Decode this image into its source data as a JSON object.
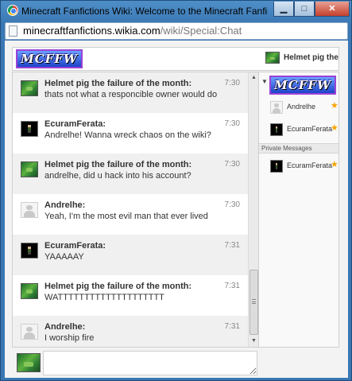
{
  "window": {
    "title": "Minecraft Fanfictions Wiki: Welcome to the Minecraft Fanfictions ...",
    "minimize_glyph": "▁",
    "maximize_glyph": "□",
    "close_glyph": "✕"
  },
  "address": {
    "domain": "minecraftfanfictions.wikia.com",
    "path": "/wiki/Special:Chat"
  },
  "header": {
    "logo_text": "MCFFW",
    "current_user": "Helmet pig the ..."
  },
  "messages": [
    {
      "author": "Helmet pig the failure of the month:",
      "text": "thats not what a responcible owner would do",
      "time": "7:30",
      "avatar": "pig-avatar-icon"
    },
    {
      "author": "EcuramFerata:",
      "text": "Andrelhe! Wanna wreck chaos on the wiki?",
      "time": "7:30",
      "avatar": "character-avatar-icon"
    },
    {
      "author": "Helmet pig the failure of the month:",
      "text": "andrelhe, did u hack into his account?",
      "time": "7:30",
      "avatar": "pig-avatar-icon"
    },
    {
      "author": "Andrelhe:",
      "text": "Yeah, I'm the most evil man that ever lived",
      "time": "7:30",
      "avatar": "default-avatar-icon"
    },
    {
      "author": "EcuramFerata:",
      "text": "YAAAAAY",
      "time": "7:31",
      "avatar": "character-avatar-icon"
    },
    {
      "author": "Helmet pig the failure of the month:",
      "text": "WATTTTTTTTTTTTTTTTTTTT",
      "time": "7:31",
      "avatar": "pig-avatar-icon"
    },
    {
      "author": "Andrelhe:",
      "text": "I worship fire",
      "time": "7:31",
      "avatar": "default-avatar-icon"
    }
  ],
  "scrollbar": {
    "up_glyph": "▲",
    "down_glyph": "▼"
  },
  "sidebar": {
    "collapse_glyph": "▼",
    "logo_text": "MCFFW",
    "star_glyph": "★",
    "members": [
      {
        "name": "Andrelhe",
        "avatar": "default-avatar-icon"
      },
      {
        "name": "EcuramFerata",
        "avatar": "character-avatar-icon"
      }
    ],
    "private_messages_label": "Private Messages",
    "private_messages": [
      {
        "name": "EcuramFerata",
        "avatar": "character-avatar-icon"
      }
    ]
  },
  "composer": {
    "value": "",
    "placeholder": ""
  },
  "colors": {
    "window_frame": "#3a77b3",
    "logo_fill": "#1d42c8",
    "logo_border": "#9b42d6",
    "star": "#f6a400",
    "alt_row": "#f0f0f0"
  }
}
